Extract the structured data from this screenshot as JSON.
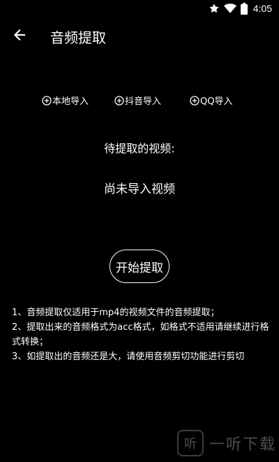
{
  "status_bar": {
    "time": "4:05",
    "icons": [
      "star-icon",
      "wifi-icon",
      "battery-icon"
    ]
  },
  "app_bar": {
    "back_icon": "arrow-left-icon",
    "title": "音频提取"
  },
  "import": {
    "local": "本地导入",
    "douyin": "抖音导入",
    "qq": "QQ导入",
    "icon": "plus-circle-icon"
  },
  "video": {
    "label": "待提取的视频:",
    "status": "尚未导入视频"
  },
  "actions": {
    "start_extract": "开始提取"
  },
  "notes": [
    "1、音频提取仅适用于mp4的视频文件的音频提取；",
    "2、提取出来的音频格式为acc格式，如格式不适用请继续进行格式转换；",
    "3、如提取出的音频还是大，请使用音频剪切功能进行剪切"
  ],
  "watermark": {
    "logo": "听",
    "text": "一听下载"
  },
  "colors": {
    "background": "#000000",
    "foreground": "#ffffff"
  }
}
